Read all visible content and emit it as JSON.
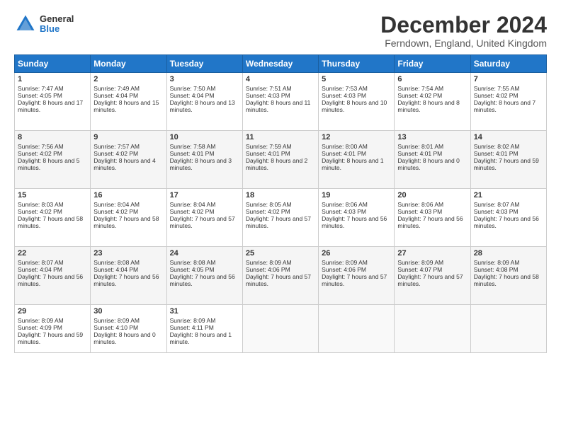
{
  "logo": {
    "general": "General",
    "blue": "Blue"
  },
  "title": "December 2024",
  "location": "Ferndown, England, United Kingdom",
  "days_header": [
    "Sunday",
    "Monday",
    "Tuesday",
    "Wednesday",
    "Thursday",
    "Friday",
    "Saturday"
  ],
  "weeks": [
    [
      {
        "day": 1,
        "sunrise": "7:47 AM",
        "sunset": "4:05 PM",
        "daylight": "8 hours and 17 minutes."
      },
      {
        "day": 2,
        "sunrise": "7:49 AM",
        "sunset": "4:04 PM",
        "daylight": "8 hours and 15 minutes."
      },
      {
        "day": 3,
        "sunrise": "7:50 AM",
        "sunset": "4:04 PM",
        "daylight": "8 hours and 13 minutes."
      },
      {
        "day": 4,
        "sunrise": "7:51 AM",
        "sunset": "4:03 PM",
        "daylight": "8 hours and 11 minutes."
      },
      {
        "day": 5,
        "sunrise": "7:53 AM",
        "sunset": "4:03 PM",
        "daylight": "8 hours and 10 minutes."
      },
      {
        "day": 6,
        "sunrise": "7:54 AM",
        "sunset": "4:02 PM",
        "daylight": "8 hours and 8 minutes."
      },
      {
        "day": 7,
        "sunrise": "7:55 AM",
        "sunset": "4:02 PM",
        "daylight": "8 hours and 7 minutes."
      }
    ],
    [
      {
        "day": 8,
        "sunrise": "7:56 AM",
        "sunset": "4:02 PM",
        "daylight": "8 hours and 5 minutes."
      },
      {
        "day": 9,
        "sunrise": "7:57 AM",
        "sunset": "4:02 PM",
        "daylight": "8 hours and 4 minutes."
      },
      {
        "day": 10,
        "sunrise": "7:58 AM",
        "sunset": "4:01 PM",
        "daylight": "8 hours and 3 minutes."
      },
      {
        "day": 11,
        "sunrise": "7:59 AM",
        "sunset": "4:01 PM",
        "daylight": "8 hours and 2 minutes."
      },
      {
        "day": 12,
        "sunrise": "8:00 AM",
        "sunset": "4:01 PM",
        "daylight": "8 hours and 1 minute."
      },
      {
        "day": 13,
        "sunrise": "8:01 AM",
        "sunset": "4:01 PM",
        "daylight": "8 hours and 0 minutes."
      },
      {
        "day": 14,
        "sunrise": "8:02 AM",
        "sunset": "4:01 PM",
        "daylight": "7 hours and 59 minutes."
      }
    ],
    [
      {
        "day": 15,
        "sunrise": "8:03 AM",
        "sunset": "4:02 PM",
        "daylight": "7 hours and 58 minutes."
      },
      {
        "day": 16,
        "sunrise": "8:04 AM",
        "sunset": "4:02 PM",
        "daylight": "7 hours and 58 minutes."
      },
      {
        "day": 17,
        "sunrise": "8:04 AM",
        "sunset": "4:02 PM",
        "daylight": "7 hours and 57 minutes."
      },
      {
        "day": 18,
        "sunrise": "8:05 AM",
        "sunset": "4:02 PM",
        "daylight": "7 hours and 57 minutes."
      },
      {
        "day": 19,
        "sunrise": "8:06 AM",
        "sunset": "4:03 PM",
        "daylight": "7 hours and 56 minutes."
      },
      {
        "day": 20,
        "sunrise": "8:06 AM",
        "sunset": "4:03 PM",
        "daylight": "7 hours and 56 minutes."
      },
      {
        "day": 21,
        "sunrise": "8:07 AM",
        "sunset": "4:03 PM",
        "daylight": "7 hours and 56 minutes."
      }
    ],
    [
      {
        "day": 22,
        "sunrise": "8:07 AM",
        "sunset": "4:04 PM",
        "daylight": "7 hours and 56 minutes."
      },
      {
        "day": 23,
        "sunrise": "8:08 AM",
        "sunset": "4:04 PM",
        "daylight": "7 hours and 56 minutes."
      },
      {
        "day": 24,
        "sunrise": "8:08 AM",
        "sunset": "4:05 PM",
        "daylight": "7 hours and 56 minutes."
      },
      {
        "day": 25,
        "sunrise": "8:09 AM",
        "sunset": "4:06 PM",
        "daylight": "7 hours and 57 minutes."
      },
      {
        "day": 26,
        "sunrise": "8:09 AM",
        "sunset": "4:06 PM",
        "daylight": "7 hours and 57 minutes."
      },
      {
        "day": 27,
        "sunrise": "8:09 AM",
        "sunset": "4:07 PM",
        "daylight": "7 hours and 57 minutes."
      },
      {
        "day": 28,
        "sunrise": "8:09 AM",
        "sunset": "4:08 PM",
        "daylight": "7 hours and 58 minutes."
      }
    ],
    [
      {
        "day": 29,
        "sunrise": "8:09 AM",
        "sunset": "4:09 PM",
        "daylight": "7 hours and 59 minutes."
      },
      {
        "day": 30,
        "sunrise": "8:09 AM",
        "sunset": "4:10 PM",
        "daylight": "8 hours and 0 minutes."
      },
      {
        "day": 31,
        "sunrise": "8:09 AM",
        "sunset": "4:11 PM",
        "daylight": "8 hours and 1 minute."
      },
      null,
      null,
      null,
      null
    ]
  ]
}
